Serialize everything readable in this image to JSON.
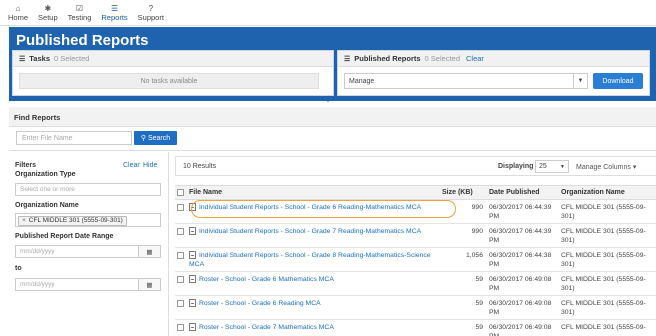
{
  "nav": {
    "items": [
      {
        "label": "Home",
        "icon": "home-icon",
        "glyph": "⌂"
      },
      {
        "label": "Setup",
        "icon": "gear-icon",
        "glyph": "✱"
      },
      {
        "label": "Testing",
        "icon": "checkbox-icon",
        "glyph": "☑"
      },
      {
        "label": "Reports",
        "icon": "reports-icon",
        "glyph": "☰",
        "active": true
      },
      {
        "label": "Support",
        "icon": "help-icon",
        "glyph": "?"
      }
    ]
  },
  "page_title": "Published Reports",
  "tasks": {
    "title": "Tasks",
    "selected": "0 Selected",
    "empty": "No tasks available"
  },
  "published": {
    "title": "Published Reports",
    "selected": "0 Selected",
    "clear": "Clear",
    "manage_value": "Manage",
    "download": "Download"
  },
  "find": {
    "title": "Find Reports",
    "placeholder": "Enter File Name",
    "search": "Search"
  },
  "filters": {
    "title": "Filters",
    "clear": "Clear",
    "hide": "Hide",
    "org_type_label": "Organization Type",
    "org_type_placeholder": "Select one or more",
    "org_name_label": "Organization Name",
    "org_name_chip": "CFL MIDDLE 301 (5555-09-301)",
    "date_range_label": "Published Report Date Range",
    "date_from_placeholder": "mm/dd/yyyy",
    "to_label": "to",
    "date_to_placeholder": "mm/dd/yyyy"
  },
  "results": {
    "count": "10 Results",
    "displaying_label": "Displaying",
    "displaying_value": "25",
    "manage_columns": "Manage Columns",
    "columns": [
      "File Name",
      "Size (KB)",
      "Date Published",
      "Organization Name"
    ],
    "rows": [
      {
        "name": "Individual Student Reports - School - Grade 6 Reading-Mathematics MCA",
        "size": "990",
        "date": "06/30/2017 06:44:39 PM",
        "org": "CFL MIDDLE 301 (5555-09-301)"
      },
      {
        "name": "Individual Student Reports - School - Grade 7 Reading-Mathematics MCA",
        "size": "990",
        "date": "06/30/2017 06:44:39 PM",
        "org": "CFL MIDDLE 301 (5555-09-301)"
      },
      {
        "name": "Individual Student Reports - School - Grade 8 Reading-Mathematics-Science MCA",
        "size": "1,056",
        "date": "06/30/2017 06:44:38 PM",
        "org": "CFL MIDDLE 301 (5555-09-301)"
      },
      {
        "name": "Roster - School - Grade 6 Mathematics MCA",
        "size": "59",
        "date": "06/30/2017 06:49:08 PM",
        "org": "CFL MIDDLE 301 (5555-09-301)"
      },
      {
        "name": "Roster - School - Grade 6 Reading MCA",
        "size": "59",
        "date": "06/30/2017 06:49:08 PM",
        "org": "CFL MIDDLE 301 (5555-09-301)"
      },
      {
        "name": "Roster - School - Grade 7 Mathematics MCA",
        "size": "59",
        "date": "06/30/2017 06:49:08 PM",
        "org": "CFL MIDDLE 301 (5555-09-"
      }
    ]
  },
  "colors": {
    "brand_blue": "#1f63ae",
    "link_blue": "#1a6fc4",
    "highlight": "#f0a33c"
  }
}
